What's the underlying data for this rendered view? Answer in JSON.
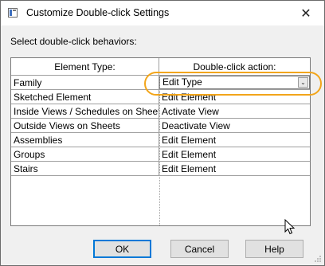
{
  "window": {
    "title": "Customize Double-click Settings",
    "close_glyph": "✕"
  },
  "prompt": "Select double-click behaviors:",
  "table": {
    "headers": [
      "Element Type:",
      "Double-click action:"
    ],
    "rows": [
      {
        "type": "Family",
        "action": "Edit Type",
        "selected": true
      },
      {
        "type": "Sketched Element",
        "action": "Edit Element"
      },
      {
        "type": "Inside Views / Schedules on Sheets",
        "action": "Activate View"
      },
      {
        "type": "Outside Views on Sheets",
        "action": "Deactivate View"
      },
      {
        "type": "Assemblies",
        "action": "Edit Element"
      },
      {
        "type": "Groups",
        "action": "Edit Element"
      },
      {
        "type": "Stairs",
        "action": "Edit Element"
      }
    ]
  },
  "dropdown_glyph": "⌄",
  "buttons": {
    "ok": "OK",
    "cancel": "Cancel",
    "help": "Help"
  },
  "colors": {
    "highlight": "#f2a51a",
    "accent": "#0078d7"
  }
}
